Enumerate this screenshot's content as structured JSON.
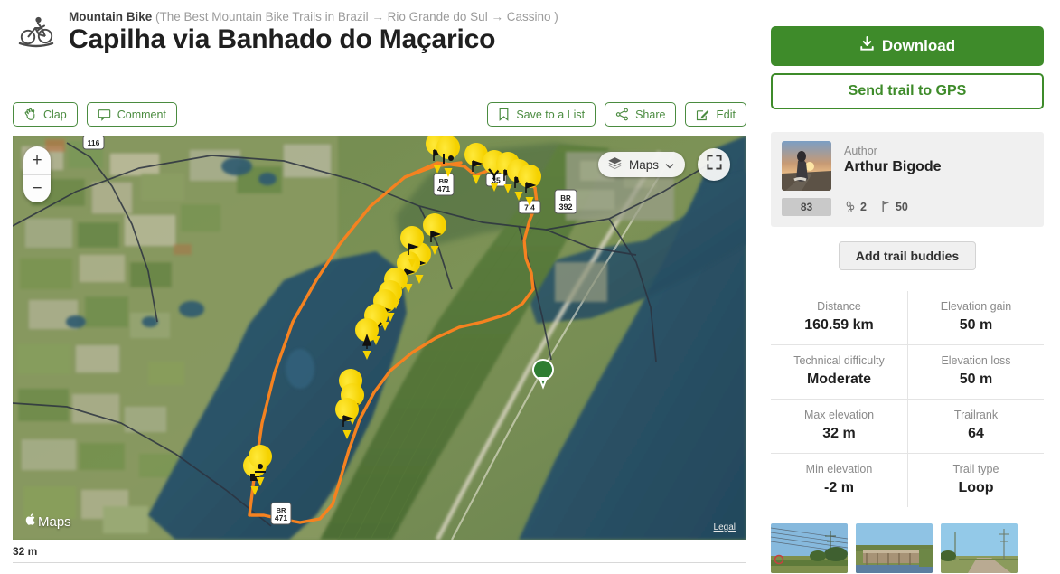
{
  "header": {
    "sport_icon": "mountain-bike-icon",
    "breadcrumb_sport": "Mountain Bike",
    "breadcrumb_path": "(The Best Mountain Bike Trails in Brazil → Rio Grande do Sul → Cassino )",
    "title": "Capilha via Banhado do Maçarico"
  },
  "actions": {
    "clap": "Clap",
    "comment": "Comment",
    "save": "Save to a List",
    "share": "Share",
    "edit": "Edit"
  },
  "map": {
    "zoom_in": "+",
    "zoom_out": "−",
    "layers_label": "Maps",
    "fullscreen_icon": "fullscreen-icon",
    "attribution": "Maps",
    "legal": "Legal",
    "scale": "32 m",
    "route_color": "#f58220",
    "marker_color": "#ffdd00",
    "end_marker_color": "#2f7d32",
    "road_shields": [
      "116",
      "BR 471",
      "35",
      "BR 392",
      "7 4",
      "BR 471"
    ]
  },
  "sidebar": {
    "download_label": "Download",
    "gps_label": "Send trail to GPS",
    "author_label": "Author",
    "author_name": "Arthur Bigode",
    "author_score": "83",
    "author_trails": "2",
    "author_flags": "50",
    "buddies_label": "Add trail buddies",
    "stats": [
      [
        {
          "label": "Distance",
          "value": "160.59 km"
        },
        {
          "label": "Elevation gain",
          "value": "50 m"
        }
      ],
      [
        {
          "label": "Technical difficulty",
          "value": "Moderate"
        },
        {
          "label": "Elevation loss",
          "value": "50 m"
        }
      ],
      [
        {
          "label": "Max elevation",
          "value": "32 m"
        },
        {
          "label": "Trailrank",
          "value": "64"
        }
      ],
      [
        {
          "label": "Min elevation",
          "value": "-2 m"
        },
        {
          "label": "Trail type",
          "value": "Loop"
        }
      ]
    ],
    "photos": [
      "photo-powerlines",
      "photo-bridge",
      "photo-dirt-road"
    ]
  },
  "colors": {
    "brand_green": "#3e8b2a",
    "outline_green": "#4a8b3f",
    "route_orange": "#f58220",
    "marker_yellow": "#ffdd00"
  }
}
